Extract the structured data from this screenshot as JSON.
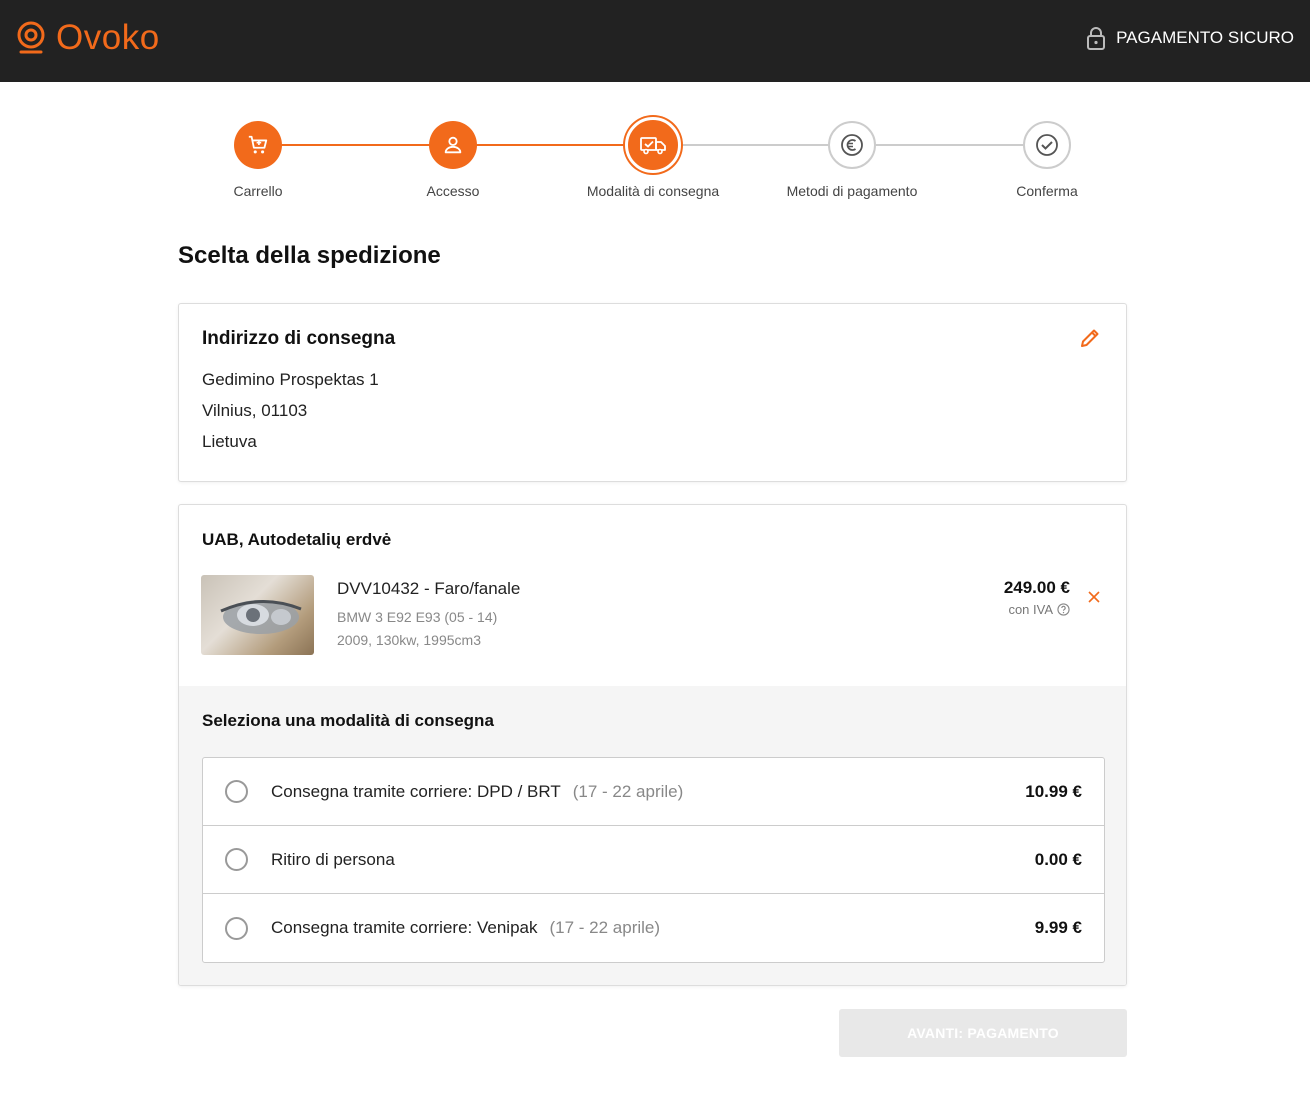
{
  "header": {
    "brand": "Ovoko",
    "secure_label": "PAGAMENTO SICURO"
  },
  "steps": [
    {
      "label": "Carrello",
      "icon": "cart-icon",
      "state": "done"
    },
    {
      "label": "Accesso",
      "icon": "user-icon",
      "state": "done"
    },
    {
      "label": "Modalità di consegna",
      "icon": "truck-icon",
      "state": "current"
    },
    {
      "label": "Metodi di pagamento",
      "icon": "euro-icon",
      "state": "todo"
    },
    {
      "label": "Conferma",
      "icon": "check-icon",
      "state": "todo"
    }
  ],
  "page_title": "Scelta della spedizione",
  "address": {
    "title": "Indirizzo di consegna",
    "line1": "Gedimino Prospektas 1",
    "line2": "Vilnius, 01103",
    "line3": "Lietuva"
  },
  "seller": {
    "name": "UAB, Autodetalių erdvė",
    "product": {
      "title": "DVV10432 - Faro/fanale",
      "car": "BMW 3 E92 E93 (05 - 14)",
      "specs": "2009, 130kw, 1995cm3",
      "price": "249.00 €",
      "vat_note": "con IVA"
    }
  },
  "delivery": {
    "title": "Seleziona una modalità di consegna",
    "options": [
      {
        "label": "Consegna tramite corriere: DPD / BRT",
        "dates": "(17 - 22 aprile)",
        "price": "10.99 €"
      },
      {
        "label": "Ritiro di persona",
        "dates": "",
        "price": "0.00 €"
      },
      {
        "label": "Consegna tramite corriere: Venipak",
        "dates": "(17 - 22 aprile)",
        "price": "9.99 €"
      }
    ]
  },
  "next_button": "AVANTI: PAGAMENTO",
  "colors": {
    "accent": "#f26a1b",
    "header_bg": "#222222",
    "disabled_button": "#e8e8e8"
  }
}
